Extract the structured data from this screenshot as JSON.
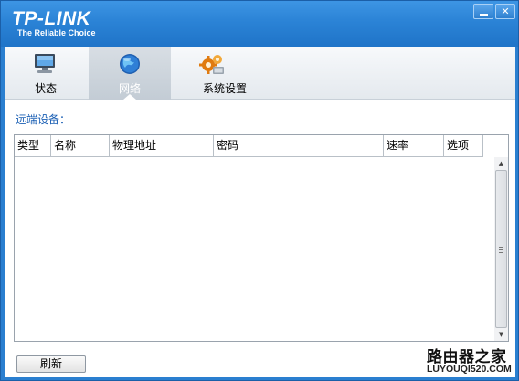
{
  "titlebar": {
    "brand": "TP-LINK",
    "tagline": "The Reliable Choice",
    "minimize_icon": "minimize-icon",
    "close_label": "✕"
  },
  "tabs": [
    {
      "label": "状态",
      "icon": "monitor-icon",
      "selected": false
    },
    {
      "label": "网络",
      "icon": "globe-icon",
      "selected": true
    },
    {
      "label": "系统设置",
      "icon": "gears-icon",
      "selected": false
    }
  ],
  "main": {
    "section_title": "远端设备：",
    "table": {
      "columns": [
        "类型",
        "名称",
        "物理地址",
        "密码",
        "速率",
        "选项"
      ],
      "rows": []
    },
    "refresh_label": "刷新"
  },
  "watermark": {
    "main": "路由器之家",
    "url": "LUYOUQI520.COM"
  },
  "colors": {
    "titlebar": "#2b83d6",
    "section_title": "#1a5fb4",
    "selected_tab": "#c3ccd5"
  }
}
